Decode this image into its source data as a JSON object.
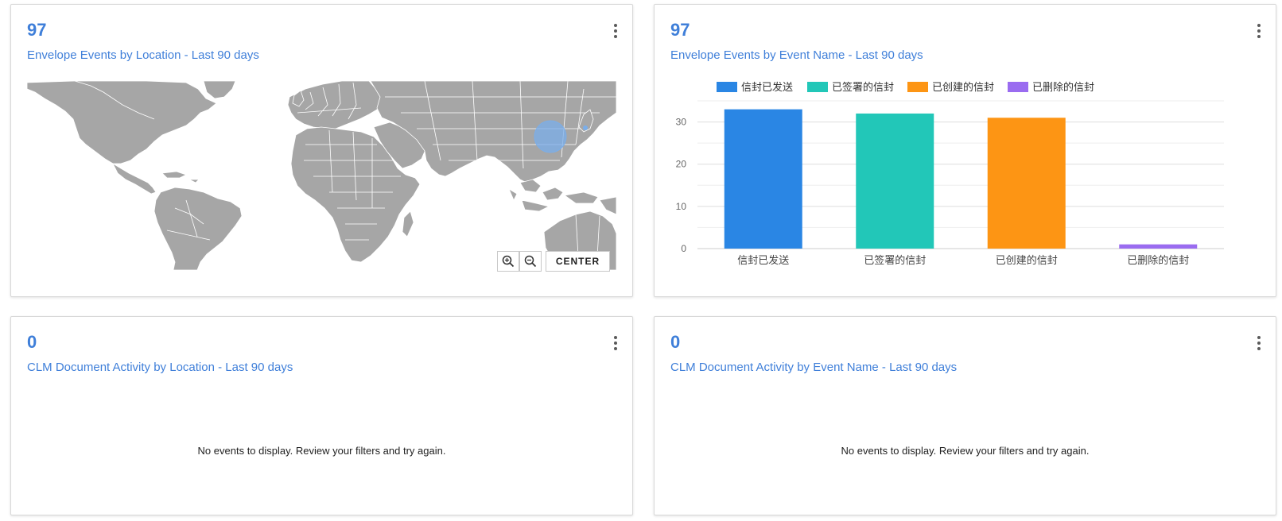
{
  "cards": [
    {
      "count": "97",
      "title": "Envelope Events by Location - Last 90 days",
      "map": {
        "zoom_in_icon": "zoom-in-icon",
        "zoom_out_icon": "zoom-out-icon",
        "center_label": "CENTER",
        "land_color": "#a6a6a6",
        "marker_color": "#7aaeea"
      }
    },
    {
      "count": "97",
      "title": "Envelope Events by Event Name - Last 90 days"
    },
    {
      "count": "0",
      "title": "CLM Document Activity by Location - Last 90 days",
      "empty_message": "No events to display. Review your filters and try again."
    },
    {
      "count": "0",
      "title": "CLM Document Activity by Event Name - Last 90 days",
      "empty_message": "No events to display. Review your filters and try again."
    }
  ],
  "chart_data": {
    "type": "bar",
    "categories": [
      "信封已发送",
      "已签署的信封",
      "已创建的信封",
      "已删除的信封"
    ],
    "values": [
      33,
      32,
      31,
      1
    ],
    "colors": [
      "#2a86e4",
      "#22c7b8",
      "#fd9514",
      "#9a6cf0"
    ],
    "legend": [
      "信封已发送",
      "已签署的信封",
      "已创建的信封",
      "已删除的信封"
    ],
    "legend_position": "top-left",
    "yticks": [
      0,
      10,
      20,
      30
    ],
    "ylim": [
      0,
      35
    ],
    "grid": true
  }
}
